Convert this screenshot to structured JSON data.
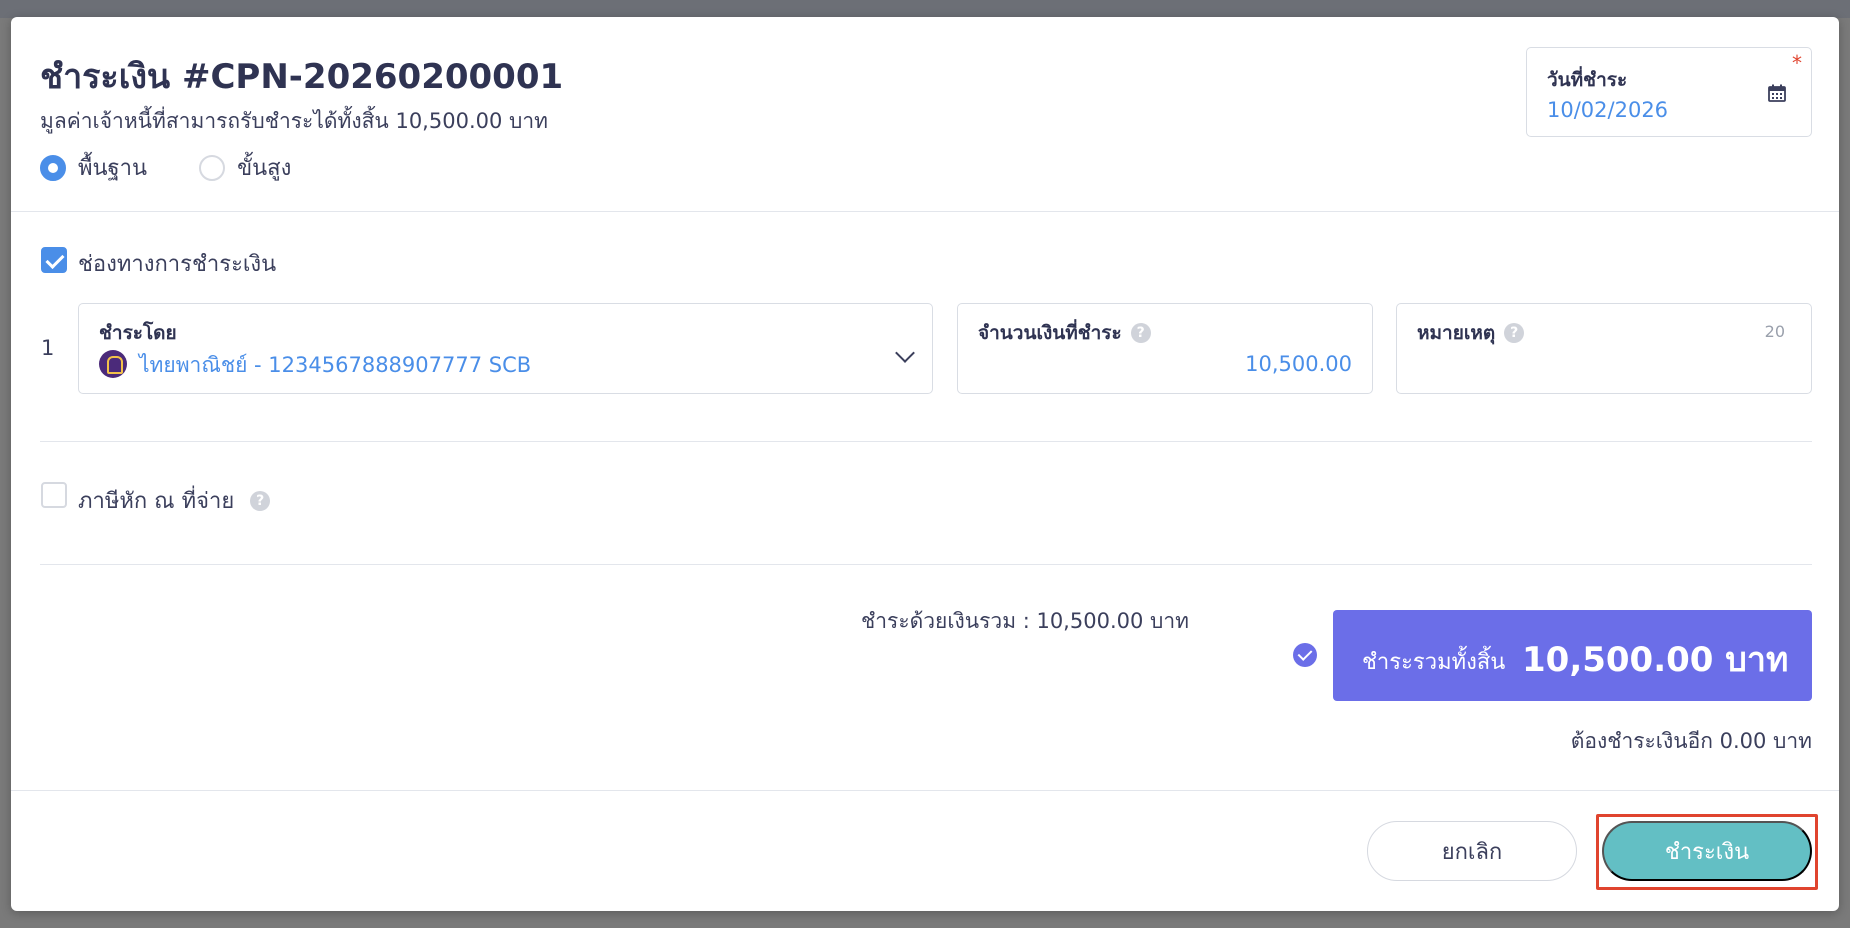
{
  "header": {
    "title": "ชำระเงิน #CPN-20260200001",
    "subtitle": "มูลค่าเจ้าหนี้ที่สามารถรับชำระได้ทั้งสิ้น 10,500.00 บาท",
    "modes": [
      {
        "label": "พื้นฐาน",
        "selected": true
      },
      {
        "label": "ขั้นสูง",
        "selected": false
      }
    ],
    "date": {
      "label": "วันที่ชำระ",
      "value": "10/02/2026",
      "required_mark": "*"
    }
  },
  "payment_channel": {
    "label": "ช่องทางการชำระเงิน",
    "checked": true,
    "rows": [
      {
        "index": "1",
        "pay_by": {
          "label": "ชำระโดย",
          "value": "ไทยพาณิชย์ - 1234567888907777 SCB",
          "bank_icon": "scb-bank-icon"
        },
        "amount": {
          "label": "จำนวนเงินที่ชำระ",
          "value": "10,500.00"
        },
        "note": {
          "label": "หมายเหตุ",
          "char_count": "20",
          "value": ""
        }
      }
    ]
  },
  "withholding_tax": {
    "label": "ภาษีหัก ณ ที่จ่าย",
    "checked": false
  },
  "totals": {
    "sum_line": "ชำระด้วยเงินรวม :  10,500.00 บาท",
    "grand_label": "ชำระรวมทั้งสิ้น",
    "grand_value": "10,500.00 บาท",
    "remaining": "ต้องชำระเงินอีก 0.00 บาท"
  },
  "footer": {
    "cancel_label": "ยกเลิก",
    "submit_label": "ชำระเงิน"
  },
  "colors": {
    "accent": "#4a8ee8",
    "total_bg": "#6b6ee8",
    "submit_bg": "#63bfc4",
    "highlight": "#e0442e"
  }
}
